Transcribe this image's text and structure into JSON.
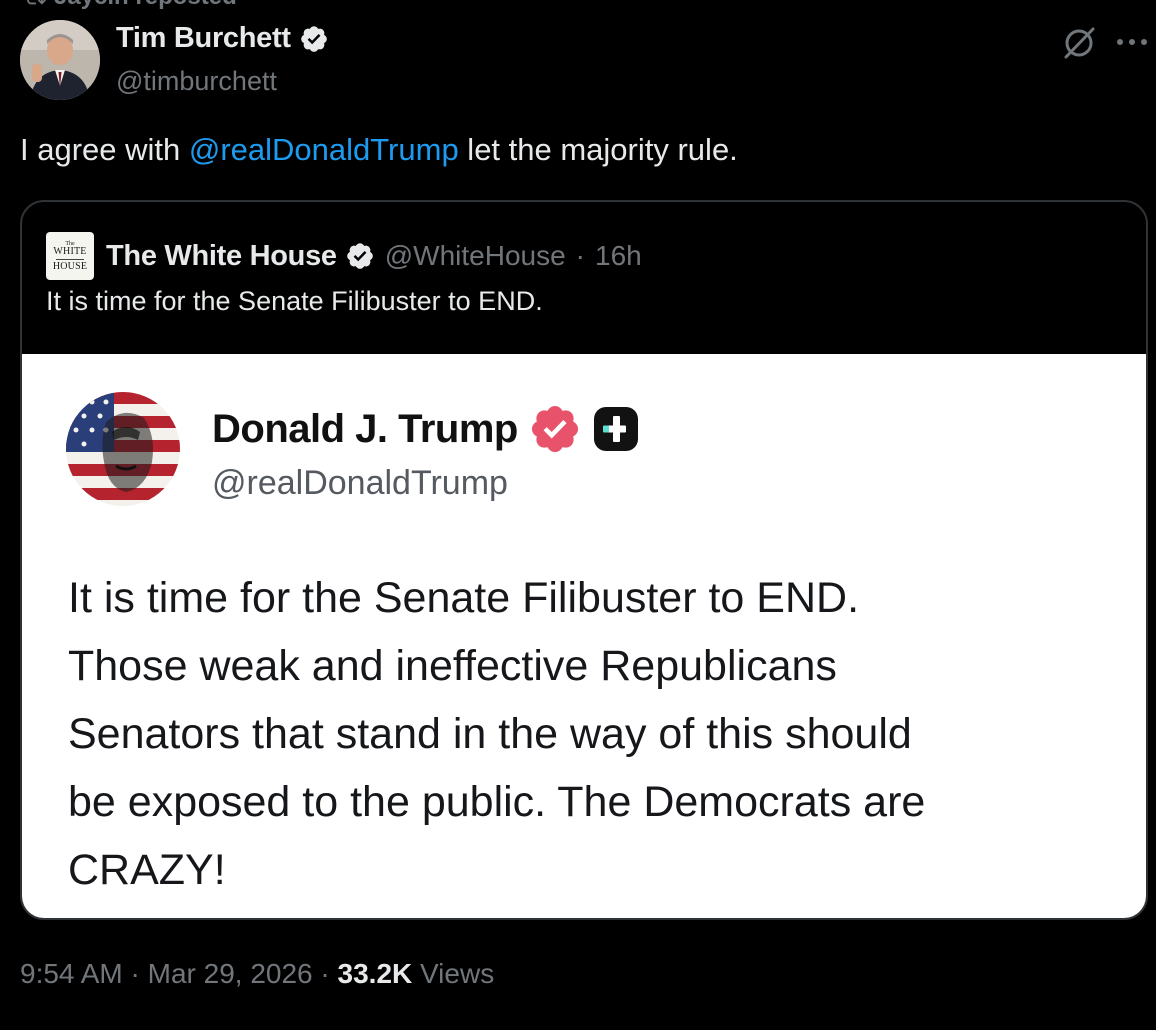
{
  "repost_banner": {
    "text": "Jaycin reposted"
  },
  "author": {
    "name": "Tim Burchett",
    "handle": "@timburchett",
    "verified": true
  },
  "tweet": {
    "text_before": "I agree with ",
    "mention": "@realDonaldTrump",
    "text_after": " let the majority rule."
  },
  "quote": {
    "logo_text_small": "The",
    "logo_text_line1": "WHITE",
    "logo_text_line2": "HOUSE",
    "name": "The White House",
    "handle": "@WhiteHouse",
    "separator": "·",
    "time": "16h",
    "text": "It is time for the Senate Filibuster to END.",
    "image_post": {
      "name": "Donald J. Trump",
      "handle": "@realDonaldTrump",
      "lines": [
        "It is time for the Senate Filibuster to END.",
        "Those weak and ineffective Republicans",
        "Senators that stand in the way of this should",
        "be exposed to the public. The Democrats are",
        "CRAZY!"
      ]
    }
  },
  "footer": {
    "time": "9:54 AM",
    "sep1": "·",
    "date": "Mar 29, 2026",
    "sep2": "·",
    "views_count": "33.2K",
    "views_label": " Views"
  },
  "icons": {
    "repost": "repost-icon",
    "verified": "verified-badge-icon",
    "grok": "grok-icon",
    "more": "more-icon",
    "truth_verified": "truth-verified-badge-icon",
    "truth_plus": "truth-plus-icon"
  },
  "colors": {
    "background": "#000000",
    "text": "#e7e9ea",
    "secondary": "#71767b",
    "link": "#1d9bf0",
    "border": "#2f3336",
    "truth_badge": "#e8536b"
  }
}
